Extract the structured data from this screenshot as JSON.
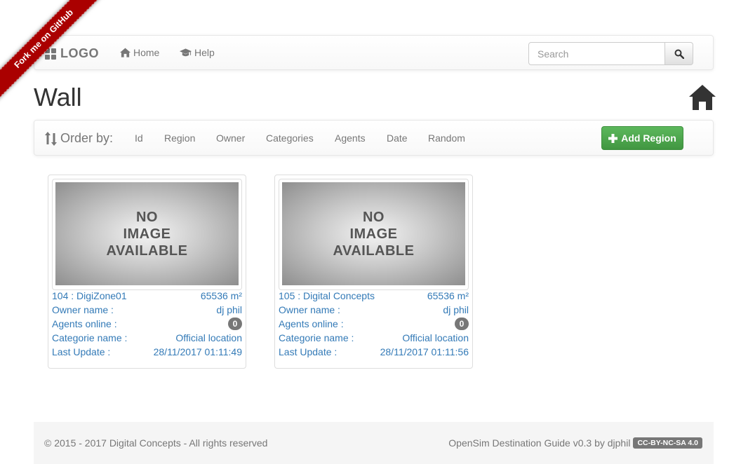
{
  "ribbon": {
    "text": "Fork me on GitHub"
  },
  "navbar": {
    "brand": "LOGO",
    "links": [
      {
        "label": "Home",
        "icon": "home-icon"
      },
      {
        "label": "Help",
        "icon": "graduation-cap-icon"
      }
    ],
    "search": {
      "placeholder": "Search",
      "value": ""
    }
  },
  "page": {
    "title": "Wall"
  },
  "orderbar": {
    "label": "Order by:",
    "options": [
      "Id",
      "Region",
      "Owner",
      "Categories",
      "Agents",
      "Date",
      "Random"
    ],
    "add_button": "Add Region"
  },
  "regions": [
    {
      "image_text": [
        "NO",
        "IMAGE",
        "AVAILABLE"
      ],
      "title": "104 : DigiZone01",
      "size": "65536 m²",
      "owner_label": "Owner name :",
      "owner": "dj phil",
      "agents_label": "Agents online :",
      "agents": "0",
      "category_label": "Categorie name :",
      "category": "Official location",
      "update_label": "Last Update :",
      "update": "28/11/2017 01:11:49"
    },
    {
      "image_text": [
        "NO",
        "IMAGE",
        "AVAILABLE"
      ],
      "title": "105 : Digital Concepts",
      "size": "65536 m²",
      "owner_label": "Owner name :",
      "owner": "dj phil",
      "agents_label": "Agents online :",
      "agents": "0",
      "category_label": "Categorie name :",
      "category": "Official location",
      "update_label": "Last Update :",
      "update": "28/11/2017 01:11:56"
    }
  ],
  "footer": {
    "copyright": "© 2015 - 2017 Digital Concepts - All rights reserved",
    "credit": "OpenSim Destination Guide v0.3 by djphil",
    "license": "CC-BY-NC-SA 4.0"
  },
  "colors": {
    "link": "#337ab7",
    "success": "#5cb85c",
    "ribbon": "#aa0000",
    "muted": "#777777"
  }
}
